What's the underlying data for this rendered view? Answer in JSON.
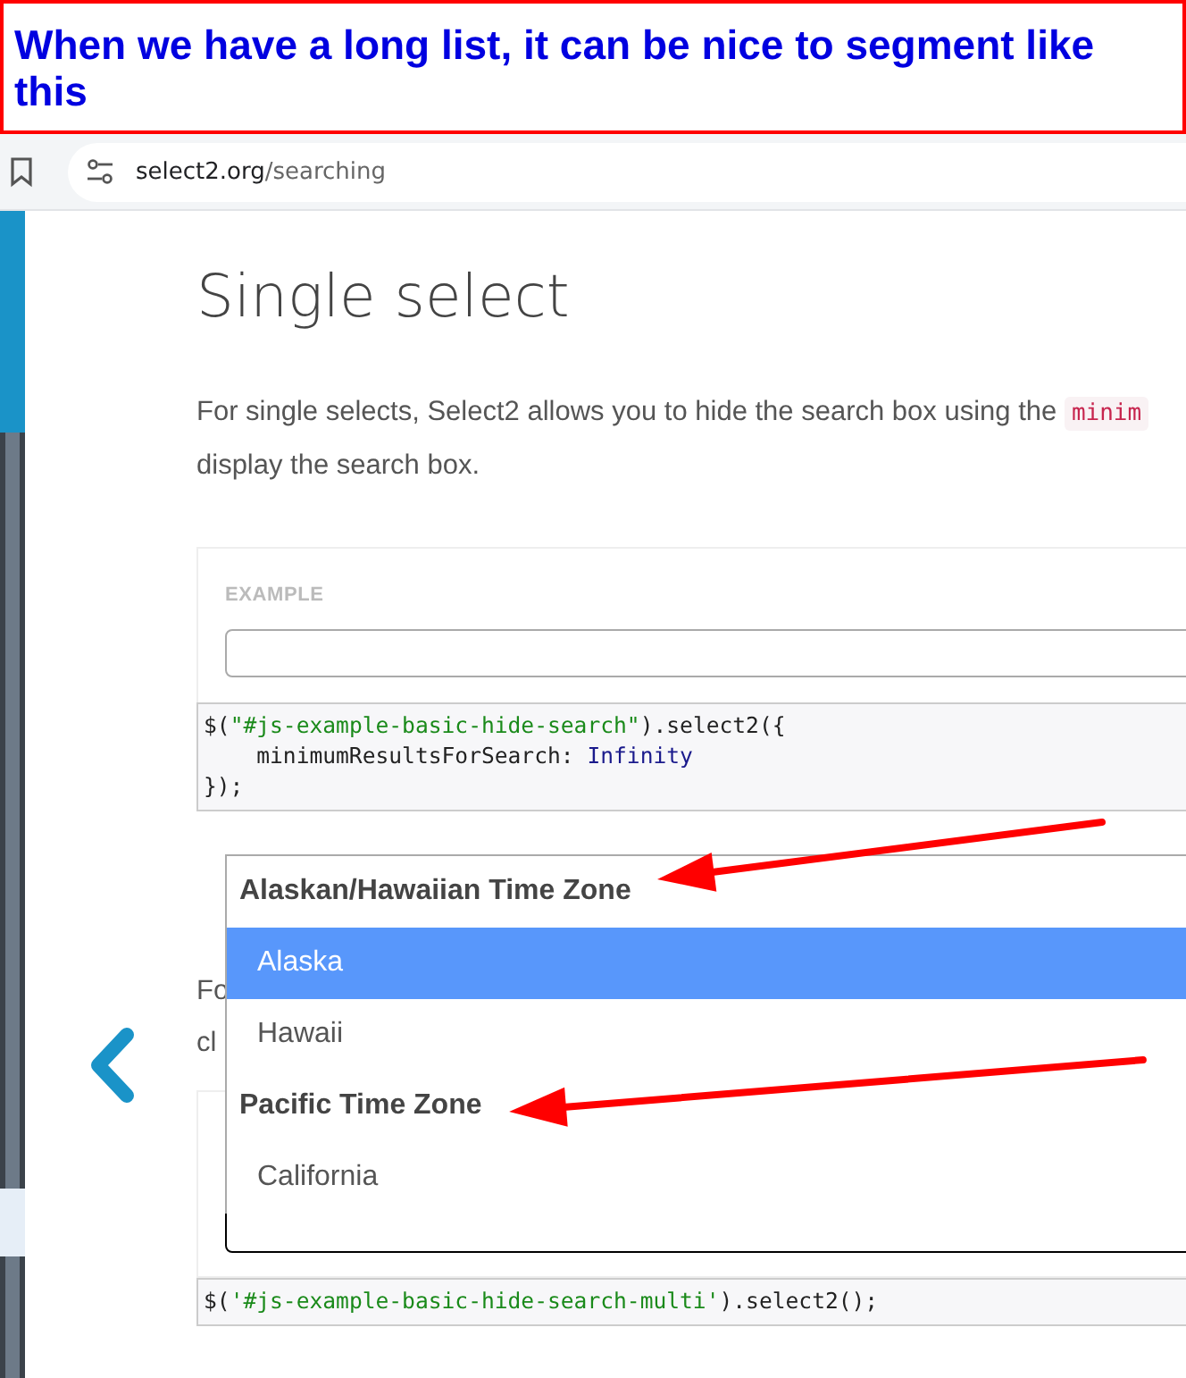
{
  "annotation": {
    "text": "When we have a long list, it can be nice to segment like this"
  },
  "browser": {
    "url_host": "select2.org",
    "url_path": "/searching"
  },
  "page": {
    "heading": "Single select",
    "paragraph": {
      "line_1": "For single selects, Select2 allows you to hide the search box using the",
      "code": "minim",
      "line_2": "display the search box."
    },
    "example": {
      "label": "EXAMPLE",
      "code_lines": [
        [
          {
            "kind": "plain",
            "text": "$("
          },
          {
            "kind": "string",
            "text": "\"#js-example-basic-hide-search\""
          },
          {
            "kind": "plain",
            "text": ").select2({"
          }
        ],
        [
          {
            "kind": "plain",
            "text": "    minimumResultsForSearch: "
          },
          {
            "kind": "keyword",
            "text": "Infinity"
          }
        ],
        [
          {
            "kind": "plain",
            "text": "});"
          }
        ]
      ]
    },
    "paragraph_2": [
      "Fo",
      "cl"
    ],
    "example_2": {
      "code_lines": [
        [
          {
            "kind": "plain",
            "text": "$("
          },
          {
            "kind": "string",
            "text": "'#js-example-basic-hide-search-multi'"
          },
          {
            "kind": "plain",
            "text": ").select2();"
          }
        ]
      ]
    }
  },
  "dropdown": {
    "items": [
      {
        "kind": "group",
        "label": "Alaskan/Hawaiian Time Zone"
      },
      {
        "kind": "option",
        "label": "Alaska",
        "selected": true
      },
      {
        "kind": "option",
        "label": "Hawaii",
        "selected": false
      },
      {
        "kind": "group",
        "label": "Pacific Time Zone"
      },
      {
        "kind": "option",
        "label": "California",
        "selected": false
      }
    ]
  }
}
